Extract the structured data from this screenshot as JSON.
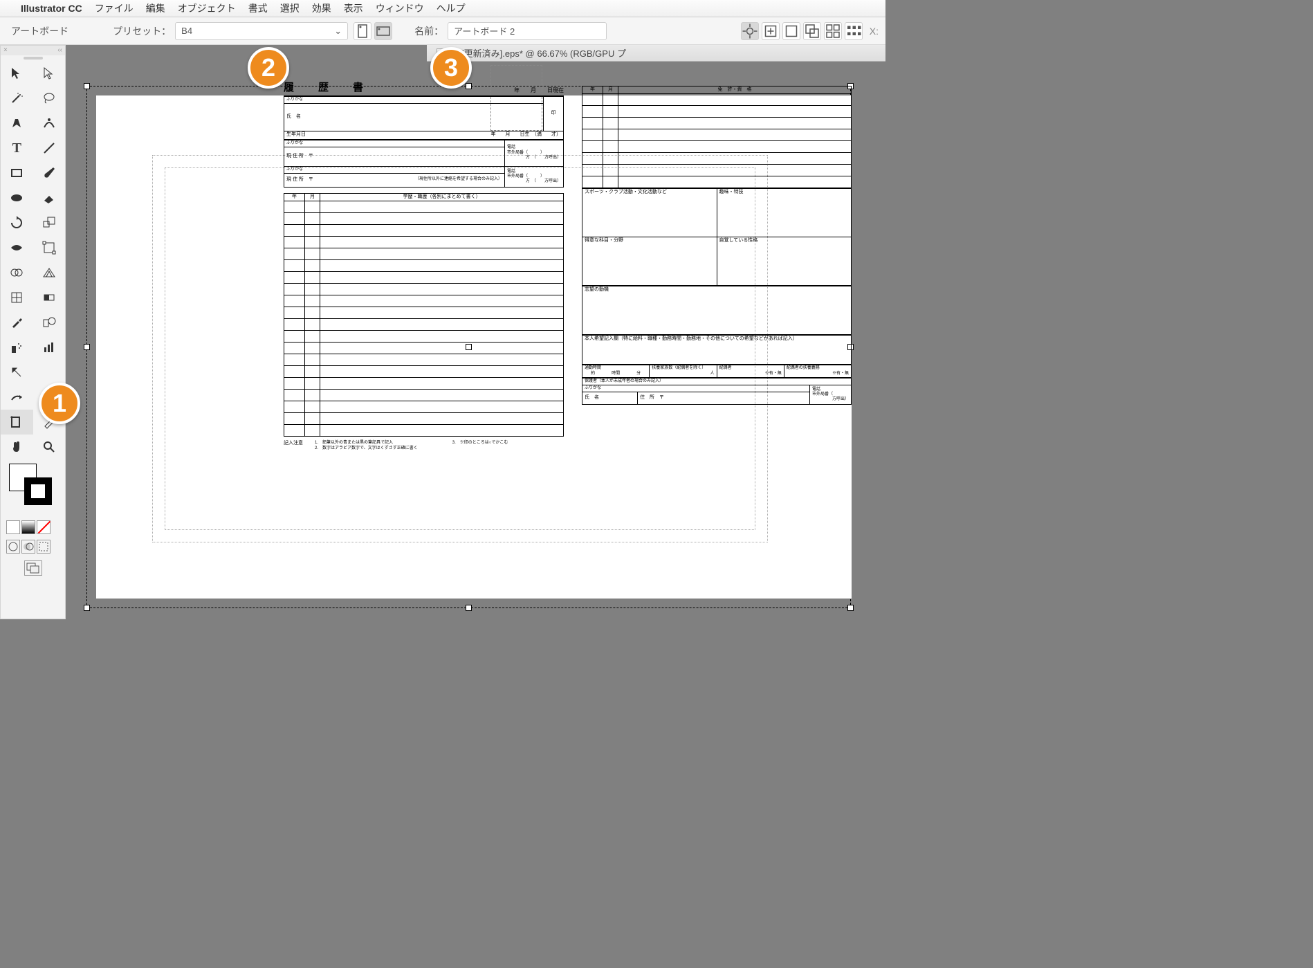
{
  "menubar": {
    "app_name": "Illustrator CC",
    "items": [
      "ファイル",
      "編集",
      "オブジェクト",
      "書式",
      "選択",
      "効果",
      "表示",
      "ウィンドウ",
      "ヘルプ"
    ]
  },
  "controlbar": {
    "tool_label": "アートボード",
    "preset_label": "プリセット：",
    "preset_value": "B4",
    "name_label": "名前：",
    "name_value": "アートボード 2",
    "x_label": "X:"
  },
  "doc_tab": {
    "title": "b5 [更新済み].eps* @ 66.67% (RGB/GPU プ"
  },
  "callouts": {
    "c1": "1",
    "c2": "2",
    "c3": "3"
  },
  "form_left": {
    "title": "履　歴　書",
    "date_suffix": "年　　月　　日現在",
    "furigana": "ふりがな",
    "name_lbl": "氏　名",
    "seal": "印",
    "birth": "生年月日",
    "birth_suffix": "年　　月　　日生　（満　　才）",
    "address_lbl": "現 住 所　〒",
    "phone": "電話",
    "mobile": "市外局番（　　　）",
    "direction": "方　（　　方呼出）",
    "contact_note": "（現住所以外に連絡を希望する場合のみ記入）",
    "history_header_year": "年",
    "history_header_month": "月",
    "history_header": "学歴・職歴（各別にまとめて書く）",
    "notes_label": "記入注意",
    "note1": "1.　鉛筆以外の青または黒の筆記具で記入",
    "note2": "2.　数字はアラビア数字で、文字はくずさず正確に書く",
    "note3": "3.　※印のところは○でかこむ"
  },
  "form_right": {
    "year": "年",
    "month": "月",
    "license_header": "免　許・資　格",
    "sports": "スポーツ・クラブ活動・文化活動など",
    "hobby": "趣味・特技",
    "subject": "得意な科目・分野",
    "personality": "自覚している性格",
    "motivation": "志望の動機",
    "wishes": "本人希望記入欄（特に給料・職種・勤務時間・勤務地・その他についての希望などがあれば記入）",
    "commute": "通勤時間",
    "commute_val": "約　　　　時間　　　　分",
    "dependents": "扶養家族数（配偶者を除く）",
    "dependents_val": "人",
    "spouse": "配偶者",
    "spouse_val": "※有・無",
    "spouse_support": "配偶者の扶養義務",
    "spouse_support_val": "※有・無",
    "guardian": "保護者（本人が未成年者の場合のみ記入）",
    "g_furigana": "ふりがな",
    "g_name": "氏　名",
    "g_addr": "住　所　〒",
    "g_phone": "電話",
    "g_mobile": "市外局番（",
    "g_dir": "方呼出）"
  }
}
